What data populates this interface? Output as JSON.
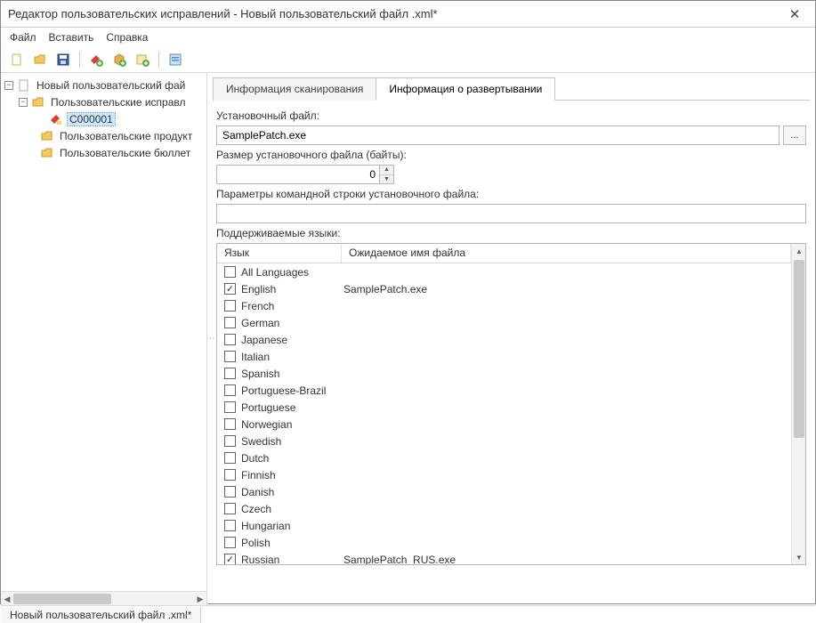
{
  "window": {
    "title": "Редактор пользовательских исправлений - Новый пользовательский файл .xml*"
  },
  "menu": {
    "file": "Файл",
    "insert": "Вставить",
    "help": "Справка"
  },
  "tree": {
    "root": "Новый пользовательский фай",
    "patches": "Пользовательские исправл",
    "selected_patch": "C000001",
    "products": "Пользовательские продукт",
    "bulletins": "Пользовательские бюллет"
  },
  "tabs": {
    "scan": "Информация сканирования",
    "deploy": "Информация о развертывании"
  },
  "form": {
    "install_file_label": "Установочный файл:",
    "install_file_value": "SamplePatch.exe",
    "size_label": "Размер установочного файла (байты):",
    "size_value": "0",
    "cmdline_label": "Параметры командной строки установочного файла:",
    "cmdline_value": "",
    "langs_label": "Поддерживаемые языки:"
  },
  "lang_table": {
    "col_lang": "Язык",
    "col_file": "Ожидаемое имя файла",
    "rows": [
      {
        "checked": false,
        "name": "All Languages",
        "file": ""
      },
      {
        "checked": true,
        "name": "English",
        "file": "SamplePatch.exe"
      },
      {
        "checked": false,
        "name": "French",
        "file": ""
      },
      {
        "checked": false,
        "name": "German",
        "file": ""
      },
      {
        "checked": false,
        "name": "Japanese",
        "file": ""
      },
      {
        "checked": false,
        "name": "Italian",
        "file": ""
      },
      {
        "checked": false,
        "name": "Spanish",
        "file": ""
      },
      {
        "checked": false,
        "name": "Portuguese-Brazil",
        "file": ""
      },
      {
        "checked": false,
        "name": "Portuguese",
        "file": ""
      },
      {
        "checked": false,
        "name": "Norwegian",
        "file": ""
      },
      {
        "checked": false,
        "name": "Swedish",
        "file": ""
      },
      {
        "checked": false,
        "name": "Dutch",
        "file": ""
      },
      {
        "checked": false,
        "name": "Finnish",
        "file": ""
      },
      {
        "checked": false,
        "name": "Danish",
        "file": ""
      },
      {
        "checked": false,
        "name": "Czech",
        "file": ""
      },
      {
        "checked": false,
        "name": "Hungarian",
        "file": ""
      },
      {
        "checked": false,
        "name": "Polish",
        "file": ""
      },
      {
        "checked": true,
        "name": "Russian",
        "file": "SamplePatch_RUS.exe"
      }
    ]
  },
  "status": {
    "file": "Новый пользовательский файл .xml*"
  },
  "icons": {
    "browse": "..."
  }
}
